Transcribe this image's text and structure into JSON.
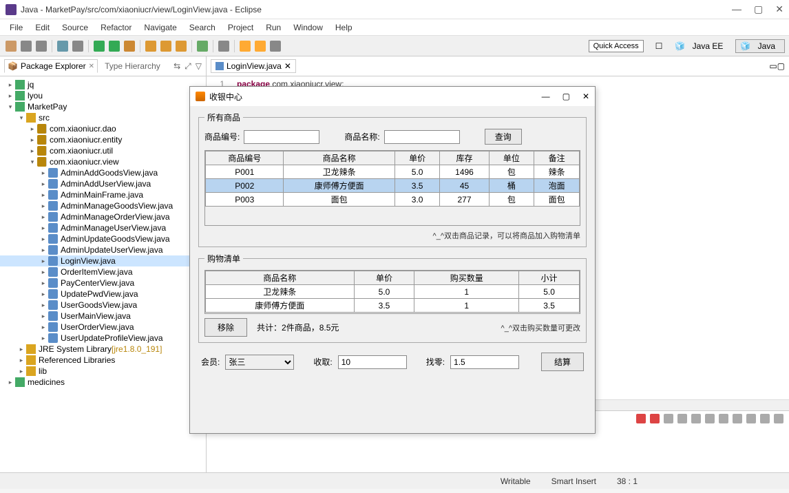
{
  "window": {
    "title": "Java - MarketPay/src/com/xiaoniucr/view/LoginView.java - Eclipse"
  },
  "menu": [
    "File",
    "Edit",
    "Source",
    "Refactor",
    "Navigate",
    "Search",
    "Project",
    "Run",
    "Window",
    "Help"
  ],
  "quick_access": "Quick Access",
  "perspectives": {
    "javaee": "Java EE",
    "java": "Java"
  },
  "pkg_explorer": {
    "tab_label": "Package Explorer",
    "other_tab": "Type Hierarchy",
    "tree": {
      "jq": "jq",
      "lyou": "lyou",
      "marketpay": "MarketPay",
      "src": "src",
      "dao": "com.xiaoniucr.dao",
      "entity": "com.xiaoniucr.entity",
      "util": "com.xiaoniucr.util",
      "view": "com.xiaoniucr.view",
      "files": [
        "AdminAddGoodsView.java",
        "AdminAddUserView.java",
        "AdminMainFrame.java",
        "AdminManageGoodsView.java",
        "AdminManageOrderView.java",
        "AdminManageUserView.java",
        "AdminUpdateGoodsView.java",
        "AdminUpdateUserView.java",
        "LoginView.java",
        "OrderItemView.java",
        "PayCenterView.java",
        "UpdatePwdView.java",
        "UserGoodsView.java",
        "UserMainView.java",
        "UserOrderView.java",
        "UserUpdateProfileView.java"
      ],
      "jre": "JRE System Library",
      "jre_ver": "[jre1.8.0_191]",
      "reflib": "Referenced Libraries",
      "lib": "lib",
      "medicines": "medicines"
    }
  },
  "editor": {
    "tab": "LoginView.java",
    "line_no": "1",
    "kw": "package",
    "pkg": "com.xiaoniucr.view;"
  },
  "status": {
    "writable": "Writable",
    "insert": "Smart Insert",
    "pos": "38 : 1"
  },
  "dialog": {
    "title": "收银中心",
    "all_goods": "所有商品",
    "code_label": "商品编号:",
    "name_label": "商品名称:",
    "query": "查询",
    "goods_cols": [
      "商品编号",
      "商品名称",
      "单价",
      "库存",
      "单位",
      "备注"
    ],
    "goods_rows": [
      [
        "P001",
        "卫龙辣条",
        "5.0",
        "1496",
        "包",
        "辣条"
      ],
      [
        "P002",
        "康师傅方便面",
        "3.5",
        "45",
        "桶",
        "泡面"
      ],
      [
        "P003",
        "面包",
        "3.0",
        "277",
        "包",
        "面包"
      ]
    ],
    "goods_hint": "^_^双击商品记录，可以将商品加入购物清单",
    "cart": "购物清单",
    "cart_cols": [
      "商品名称",
      "单价",
      "购买数量",
      "小计"
    ],
    "cart_rows": [
      [
        "卫龙辣条",
        "5.0",
        "1",
        "5.0"
      ],
      [
        "康师傅方便面",
        "3.5",
        "1",
        "3.5"
      ]
    ],
    "remove": "移除",
    "total": "共计：2件商品，8.5元",
    "cart_hint": "^_^双击购买数量可更改",
    "member": "会员:",
    "member_val": "张三",
    "receive": "收取:",
    "receive_val": "10",
    "change": "找零:",
    "change_val": "1.5",
    "settle": "结算"
  }
}
